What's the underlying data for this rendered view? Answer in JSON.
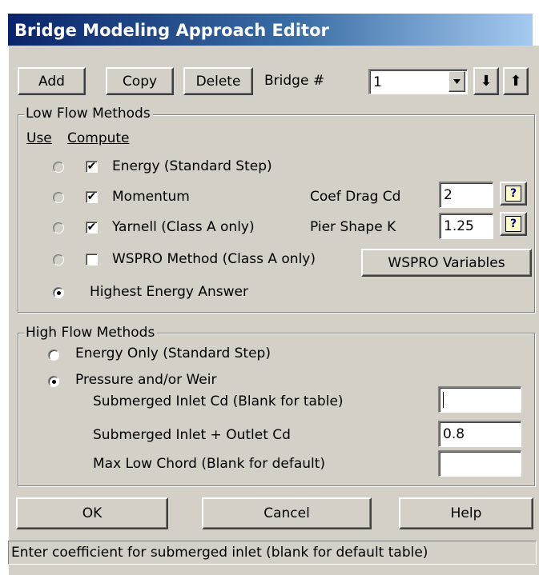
{
  "window": {
    "title": "Bridge Modeling Approach Editor"
  },
  "toolbar": {
    "add_label": "Add",
    "copy_label": "Copy",
    "delete_label": "Delete",
    "bridge_label": "Bridge #",
    "bridge_value": "1",
    "down_arrow": "⬇",
    "up_arrow": "⬆"
  },
  "low_flow": {
    "title": "Low Flow Methods",
    "col_use": "Use",
    "col_compute": "Compute",
    "methods": [
      {
        "label": "Energy (Standard Step)",
        "computed": true,
        "selected": false
      },
      {
        "label": "Momentum",
        "computed": true,
        "selected": false
      },
      {
        "label": "Yarnell (Class A only)",
        "computed": true,
        "selected": false
      },
      {
        "label": "WSPRO Method (Class A only)",
        "computed": false,
        "selected": false
      }
    ],
    "highest_energy_label": "Highest Energy Answer",
    "highest_energy_selected": true,
    "coef_drag_label": "Coef Drag Cd",
    "coef_drag_value": "2",
    "pier_shape_label": "Pier Shape K",
    "pier_shape_value": "1.25",
    "wspro_button": "WSPRO Variables",
    "check_mark": "✔",
    "help_glyph": "?"
  },
  "high_flow": {
    "title": "High Flow Methods",
    "energy_only_label": "Energy Only (Standard Step)",
    "energy_only_selected": false,
    "pressure_weir_label": "Pressure and/or Weir",
    "pressure_weir_selected": true,
    "submerged_inlet_label": "Submerged Inlet Cd (Blank for table)",
    "submerged_inlet_value": "",
    "inlet_outlet_label": "Submerged Inlet + Outlet Cd",
    "inlet_outlet_value": "0.8",
    "max_low_chord_label": "Max Low Chord (Blank for default)",
    "max_low_chord_value": ""
  },
  "footer": {
    "ok_label": "OK",
    "cancel_label": "Cancel",
    "help_label": "Help"
  },
  "status": {
    "text": "Enter coefficient for submerged inlet (blank for default table)"
  }
}
